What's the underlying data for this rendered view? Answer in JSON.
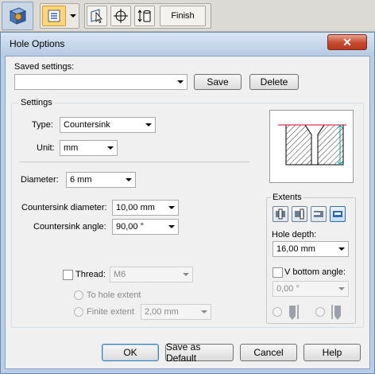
{
  "toolbar": {
    "finish_label": "Finish"
  },
  "dialog": {
    "title": "Hole Options",
    "close_glyph": "✕",
    "saved_settings": {
      "label": "Saved settings:",
      "value": "",
      "save_label": "Save",
      "delete_label": "Delete"
    },
    "settings": {
      "group_label": "Settings",
      "type_label": "Type:",
      "type_value": "Countersink",
      "unit_label": "Unit:",
      "unit_value": "mm",
      "diameter_label": "Diameter:",
      "diameter_value": "6 mm",
      "countersink_diameter_label": "Countersink diameter:",
      "countersink_diameter_value": "10,00 mm",
      "countersink_angle_label": "Countersink angle:",
      "countersink_angle_value": "90,00 °",
      "thread_label": "Thread:",
      "thread_value": "M6",
      "to_hole_extent_label": "To hole extent",
      "finite_extent_label": "Finite extent",
      "finite_extent_value": "2,00 mm"
    },
    "extents": {
      "group_label": "Extents",
      "hole_depth_label": "Hole depth:",
      "hole_depth_value": "16,00 mm",
      "v_bottom_label": "V bottom angle:",
      "v_bottom_value": "0,00 °"
    },
    "buttons": {
      "ok": "OK",
      "save_default": "Save as Default",
      "cancel": "Cancel",
      "help": "Help"
    }
  },
  "colors": {
    "preview_red": "#d9002a",
    "preview_teal": "#00a0a0",
    "hatch": "#333333"
  },
  "icons": [
    "app-cube-icon",
    "hole-options-icon",
    "dropdown-arrow-icon",
    "select-cursor-icon",
    "crosshair-icon",
    "extent-icon"
  ]
}
